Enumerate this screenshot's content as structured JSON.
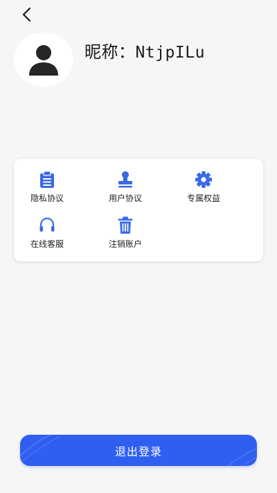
{
  "header": {
    "back_icon": "chevron-left-icon"
  },
  "profile": {
    "avatar_icon": "user-silhouette-icon",
    "nickname_label": "昵称：",
    "nickname_value": "NtjpILu"
  },
  "menu": {
    "items": [
      {
        "label": "隐私协议",
        "icon": "clipboard-list-icon"
      },
      {
        "label": "用户协议",
        "icon": "stamp-icon"
      },
      {
        "label": "专属权益",
        "icon": "gear-icon"
      },
      {
        "label": "在线客服",
        "icon": "headset-icon"
      },
      {
        "label": "注销账户",
        "icon": "trash-icon"
      }
    ]
  },
  "logout": {
    "label": "退出登录"
  },
  "colors": {
    "accent": "#2f5ff0",
    "icon_blue": "#3b6ae6",
    "background": "#f6f6f6",
    "card": "#ffffff"
  }
}
